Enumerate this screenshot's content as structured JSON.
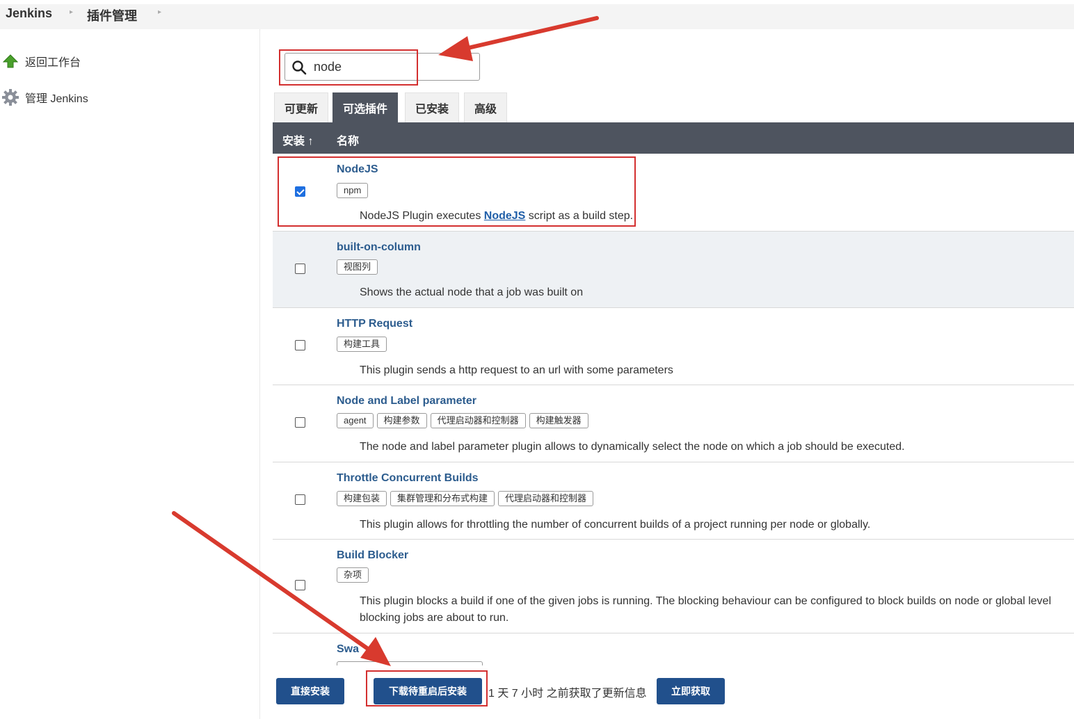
{
  "breadcrumb": {
    "root": "Jenkins",
    "current": "插件管理"
  },
  "sidebar": {
    "items": [
      {
        "label": "返回工作台",
        "icon": "up-arrow-icon"
      },
      {
        "label": "管理 Jenkins",
        "icon": "gear-icon"
      }
    ]
  },
  "search": {
    "value": "node"
  },
  "tabs": [
    {
      "label": "可更新",
      "active": false
    },
    {
      "label": "可选插件",
      "active": true
    },
    {
      "label": "已安装",
      "active": false
    },
    {
      "label": "高级",
      "active": false
    }
  ],
  "table": {
    "col_install": "安装 ↑",
    "col_name": "名称",
    "rows": [
      {
        "name": "NodeJS",
        "checked": true,
        "tags": [
          "npm"
        ],
        "desc_pre": "NodeJS Plugin executes ",
        "desc_link": "NodeJS",
        "desc_post": " script as a build step."
      },
      {
        "name": "built-on-column",
        "checked": false,
        "tags": [
          "视图列"
        ],
        "desc": "Shows the actual node that a job was built on"
      },
      {
        "name": "HTTP Request",
        "checked": false,
        "tags": [
          "构建工具"
        ],
        "desc": "This plugin sends a http request to an url with some parameters"
      },
      {
        "name": "Node and Label parameter",
        "checked": false,
        "tags": [
          "agent",
          "构建参数",
          "代理启动器和控制器",
          "构建触发器"
        ],
        "desc": "The node and label parameter plugin allows to dynamically select the node on which a job should be executed."
      },
      {
        "name": "Throttle Concurrent Builds",
        "checked": false,
        "tags": [
          "构建包装",
          "集群管理和分布式构建",
          "代理启动器和控制器"
        ],
        "desc": "This plugin allows for throttling the number of concurrent builds of a project running per node or globally."
      },
      {
        "name": "Build Blocker",
        "checked": false,
        "tags": [
          "杂项"
        ],
        "desc_line1": "This plugin blocks a build if one of the given jobs is running. The blocking behaviour can be configured to block builds on node or global level",
        "desc_line2": "blocking jobs are about to run."
      },
      {
        "name": "Swa"
      }
    ]
  },
  "bottom": {
    "install_now": "直接安装",
    "install_after_restart": "下载待重启后安装",
    "update_info": "1 天 7 小时 之前获取了更新信息",
    "check_now": "立即获取"
  },
  "colors": {
    "header_bg": "#4e545f",
    "button_bg": "#21508c",
    "link": "#2c5c8e",
    "annotation_red": "#d32f2f"
  }
}
